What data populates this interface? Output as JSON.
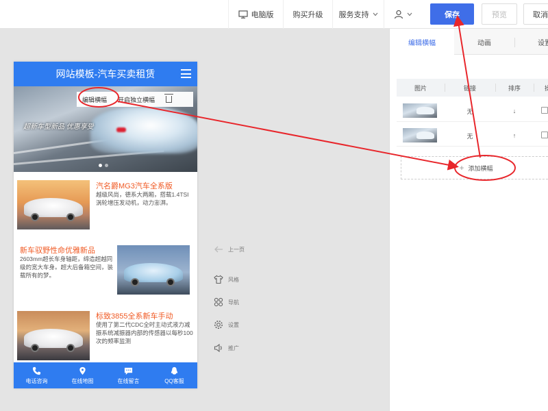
{
  "toolbar": {
    "desktop_label": "电脑版",
    "upgrade_label": "购买升级",
    "support_label": "服务支持",
    "save_label": "保存",
    "preview_label": "预览",
    "cancel_label": "取消"
  },
  "phone": {
    "header_title": "网站模板-汽车买卖租赁",
    "banner_slogan": "超新车型新品 优惠享受",
    "banner_toolbar": {
      "edit_label": "编辑横幅",
      "independent_label": "开启独立横幅"
    },
    "articles": [
      {
        "title": "汽名爵MG3汽车全系版",
        "desc": "越级风尚，德系大两厢，搭载1.4TSI涡轮增压发动机，动力澎湃。"
      },
      {
        "title": "新车驭野性命优雅新品",
        "desc": "2603mm超长车身轴距，缔造超越同级的宽大车身。超大后备箱空间，装载所有的梦。"
      },
      {
        "title": "标致3855全系新车手动",
        "desc": "使用了第二代CDC全时主动式液力减振系统减振器内部的传感器以每秒100次的频率监测"
      }
    ],
    "bottom_nav": [
      {
        "label": "电话咨询",
        "icon": "phone-icon"
      },
      {
        "label": "在线地图",
        "icon": "map-pin-icon"
      },
      {
        "label": "在线留言",
        "icon": "message-icon"
      },
      {
        "label": "QQ客服",
        "icon": "qq-icon"
      }
    ]
  },
  "side_tools": {
    "prev": "上一页",
    "style": "风格",
    "nav": "导航",
    "settings": "设置",
    "promote": "推广"
  },
  "panel": {
    "tabs": [
      "编辑横幅",
      "动画",
      "设置"
    ],
    "table_headers": [
      "图片",
      "链接",
      "排序",
      "操作"
    ],
    "rows": [
      {
        "link": "无",
        "sort": "↓"
      },
      {
        "link": "无",
        "sort": "↑"
      }
    ],
    "add_label": "添加横幅"
  },
  "colors": {
    "accent": "#3f6ee8",
    "phone_header": "#2f7cf0",
    "article_title": "#f05a24",
    "annotation": "#e8262b"
  }
}
